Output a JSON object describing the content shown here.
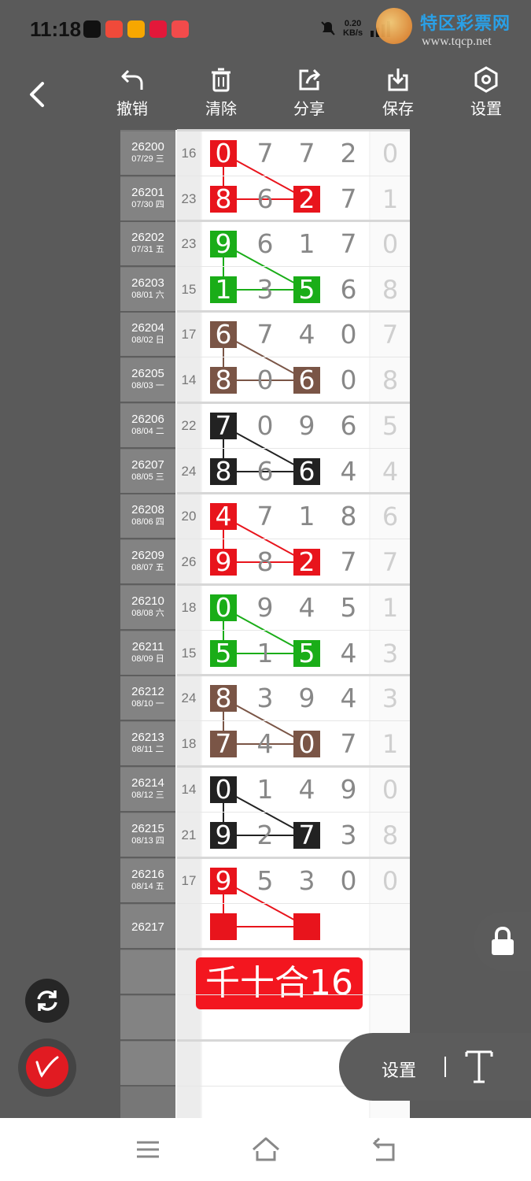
{
  "status_bar": {
    "time": "11:18",
    "net_speed_value": "0.20",
    "net_speed_unit": "KB/s",
    "icons": [
      "tiktok-icon",
      "app-icon",
      "video-icon",
      "music-icon",
      "calendar-icon",
      "mute-icon",
      "signal-icon",
      "wifi-icon",
      "battery-icon"
    ]
  },
  "watermark": {
    "title": "特区彩票网",
    "url": "www.tqcp.net"
  },
  "toolbar": {
    "back_icon": "chevron-left-icon",
    "undo_label": "撤销",
    "clear_label": "清除",
    "share_label": "分享",
    "save_label": "保存",
    "settings_label": "设置"
  },
  "rows": [
    {
      "period": "26200",
      "date": "07/29 三",
      "sum": "16",
      "digits": [
        "0",
        "7",
        "7",
        "2"
      ],
      "extra": "0"
    },
    {
      "period": "26201",
      "date": "07/30 四",
      "sum": "23",
      "digits": [
        "8",
        "6",
        "2",
        "7"
      ],
      "extra": "1"
    },
    {
      "period": "26202",
      "date": "07/31 五",
      "sum": "23",
      "digits": [
        "9",
        "6",
        "1",
        "7"
      ],
      "extra": "0"
    },
    {
      "period": "26203",
      "date": "08/01 六",
      "sum": "15",
      "digits": [
        "1",
        "3",
        "5",
        "6"
      ],
      "extra": "8"
    },
    {
      "period": "26204",
      "date": "08/02 日",
      "sum": "17",
      "digits": [
        "6",
        "7",
        "4",
        "0"
      ],
      "extra": "7"
    },
    {
      "period": "26205",
      "date": "08/03 一",
      "sum": "14",
      "digits": [
        "8",
        "0",
        "6",
        "0"
      ],
      "extra": "8"
    },
    {
      "period": "26206",
      "date": "08/04 二",
      "sum": "22",
      "digits": [
        "7",
        "0",
        "9",
        "6"
      ],
      "extra": "5"
    },
    {
      "period": "26207",
      "date": "08/05 三",
      "sum": "24",
      "digits": [
        "8",
        "6",
        "6",
        "4"
      ],
      "extra": "4"
    },
    {
      "period": "26208",
      "date": "08/06 四",
      "sum": "20",
      "digits": [
        "4",
        "7",
        "1",
        "8"
      ],
      "extra": "6"
    },
    {
      "period": "26209",
      "date": "08/07 五",
      "sum": "26",
      "digits": [
        "9",
        "8",
        "2",
        "7"
      ],
      "extra": "7"
    },
    {
      "period": "26210",
      "date": "08/08 六",
      "sum": "18",
      "digits": [
        "0",
        "9",
        "4",
        "5"
      ],
      "extra": "1"
    },
    {
      "period": "26211",
      "date": "08/09 日",
      "sum": "15",
      "digits": [
        "5",
        "1",
        "5",
        "4"
      ],
      "extra": "3"
    },
    {
      "period": "26212",
      "date": "08/10 一",
      "sum": "24",
      "digits": [
        "8",
        "3",
        "9",
        "4"
      ],
      "extra": "3"
    },
    {
      "period": "26213",
      "date": "08/11 二",
      "sum": "18",
      "digits": [
        "7",
        "4",
        "0",
        "7"
      ],
      "extra": "1"
    },
    {
      "period": "26214",
      "date": "08/12 三",
      "sum": "14",
      "digits": [
        "0",
        "1",
        "4",
        "9"
      ],
      "extra": "0"
    },
    {
      "period": "26215",
      "date": "08/13 四",
      "sum": "21",
      "digits": [
        "9",
        "2",
        "7",
        "3"
      ],
      "extra": "8"
    },
    {
      "period": "26216",
      "date": "08/14 五",
      "sum": "17",
      "digits": [
        "9",
        "5",
        "3",
        "0"
      ],
      "extra": "0"
    }
  ],
  "next_period": "26217",
  "groups": [
    {
      "color": "#e8141c",
      "rows": [
        0,
        1
      ]
    },
    {
      "color": "#1aad18",
      "rows": [
        2,
        3
      ]
    },
    {
      "color": "#7a5546",
      "rows": [
        4,
        5
      ]
    },
    {
      "color": "#222222",
      "rows": [
        6,
        7
      ]
    },
    {
      "color": "#e8141c",
      "rows": [
        8,
        9
      ]
    },
    {
      "color": "#1aad18",
      "rows": [
        10,
        11
      ]
    },
    {
      "color": "#7a5546",
      "rows": [
        12,
        13
      ]
    },
    {
      "color": "#222222",
      "rows": [
        14,
        15
      ]
    },
    {
      "color": "#e8141c",
      "rows": [
        16,
        17
      ]
    }
  ],
  "annotation": "千十合16",
  "controls": {
    "lock_icon": "lock-icon",
    "refresh_icon": "refresh-icon",
    "pen_icon": "pen-icon",
    "text_settings_label": "设置",
    "text_tool_icon": "text-tool-icon"
  },
  "nav": [
    "menu-icon",
    "home-icon",
    "back-icon"
  ]
}
